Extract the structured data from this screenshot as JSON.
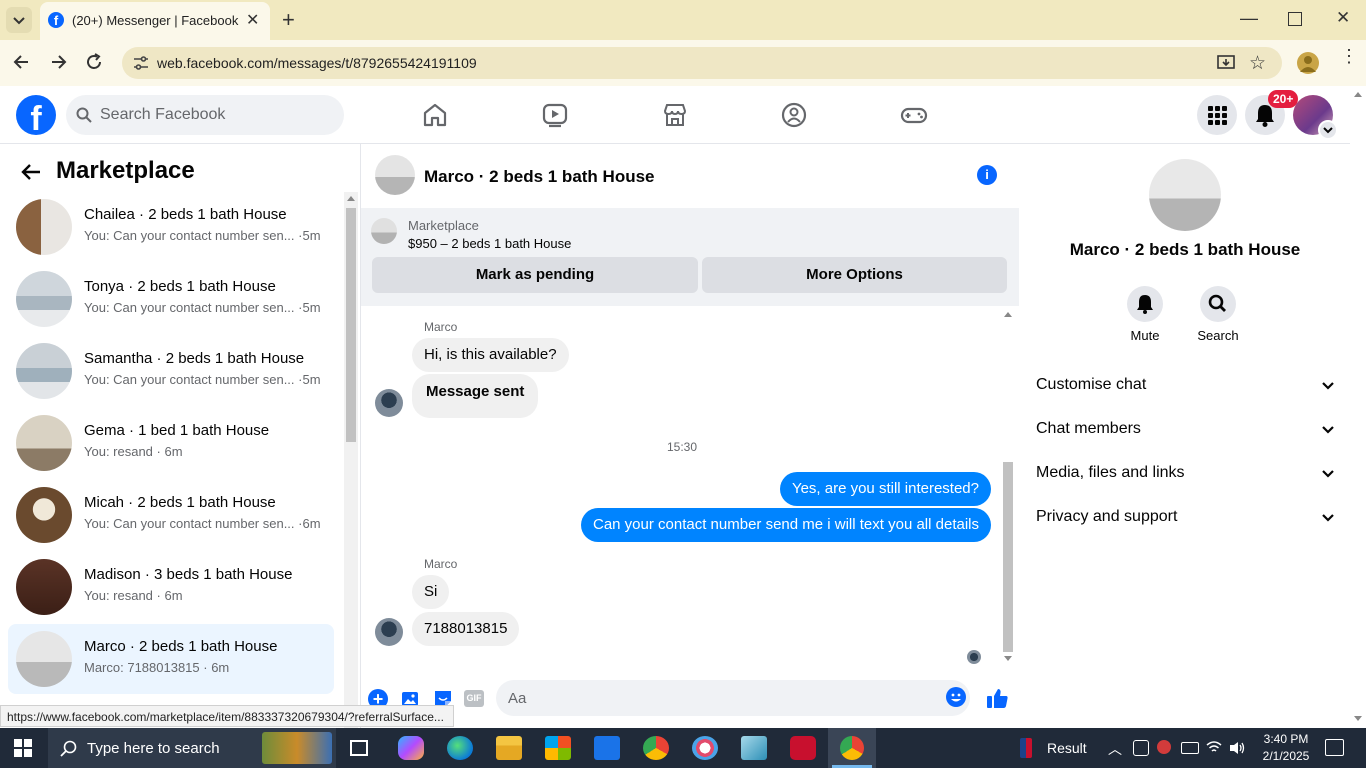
{
  "browser": {
    "tab_title": "(20+) Messenger | Facebook",
    "url": "web.facebook.com/messages/t/8792655424191109",
    "status_url": "https://www.facebook.com/marketplace/item/883337320679304/?referralSurface..."
  },
  "fb": {
    "search_placeholder": "Search Facebook",
    "notification_badge": "20+",
    "brand_color": "#0866ff"
  },
  "left": {
    "title": "Marketplace",
    "conversations": [
      {
        "name": "Chailea · 2 beds 1 bath House",
        "preview": "You: Can your contact number sen... ·5m"
      },
      {
        "name": "Tonya · 2 beds 1 bath House",
        "preview": "You: Can your contact number sen... ·5m"
      },
      {
        "name": "Samantha · 2 beds 1 bath House",
        "preview": "You: Can your contact number sen... ·5m"
      },
      {
        "name": "Gema · 1 bed 1 bath House",
        "preview": "You: resand · 6m"
      },
      {
        "name": "Micah · 2 beds 1 bath House",
        "preview": "You: Can your contact number sen... ·6m"
      },
      {
        "name": "Madison · 3 beds 1 bath House",
        "preview": "You: resand · 6m"
      },
      {
        "name": "Marco · 2 beds 1 bath House",
        "preview": "Marco: 7188013815 · 6m"
      }
    ]
  },
  "chat": {
    "title": "Marco · 2 beds 1 bath House",
    "listing_source": "Marketplace",
    "listing_price": "$950 – 2 beds 1 bath House",
    "mark_pending": "Mark as pending",
    "more_options": "More Options",
    "sender1": "Marco",
    "msg1": "Hi, is this available?",
    "msg2": "Message sent",
    "time": "15:30",
    "out1": "Yes, are you still interested?",
    "out2": "Can your contact number send me i will text you all details",
    "sender2": "Marco",
    "msg3": "Si",
    "msg4": "7188013815",
    "composer_placeholder": "Aa",
    "composer_gif": "GIF"
  },
  "details": {
    "name": "Marco · 2 beds 1 bath House",
    "mute": "Mute",
    "search": "Search",
    "sections": [
      "Customise chat",
      "Chat members",
      "Media, files and links",
      "Privacy and support"
    ]
  },
  "taskbar": {
    "search_placeholder": "Type here to search",
    "weather": "Result",
    "time": "3:40 PM",
    "date": "2/1/2025"
  }
}
